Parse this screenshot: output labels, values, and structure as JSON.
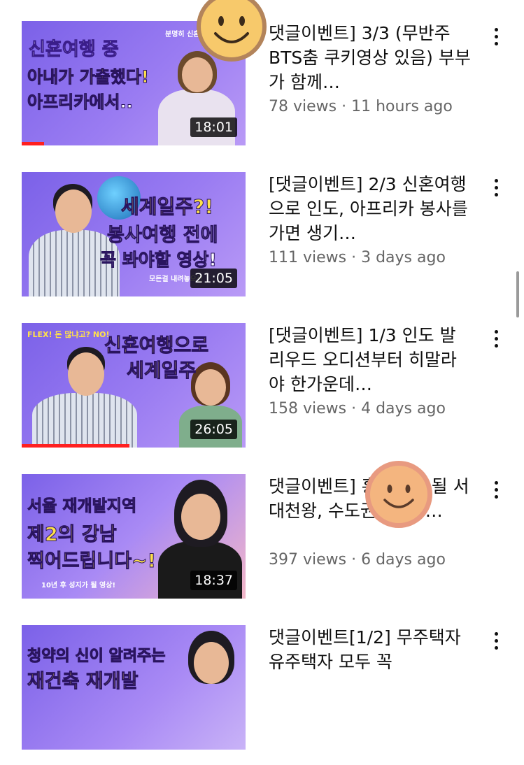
{
  "videos": [
    {
      "title": "댓글이벤트] 3/3 (무반주 BTS춤 쿠키영상 있음) 부부가 함께…",
      "meta": "78 views · 11 hours ago",
      "duration": "18:01",
      "progress": 0.1,
      "thumb_lines": [
        "신혼여행 중",
        "아내가 가출했다!",
        "아프리카에서.."
      ],
      "thumb_small": "분명히 신혼"
    },
    {
      "title": "[댓글이벤트] 2/3 신혼여행으로 인도, 아프리카 봉사를 가면 생기…",
      "meta": "111 views · 3 days ago",
      "duration": "21:05",
      "progress": 0,
      "thumb_lines": [
        "세계일주?!",
        "봉사여행 전에",
        "꼭 봐야할 영상!"
      ],
      "thumb_small": "모든걸 내려놓으신"
    },
    {
      "title": "[댓글이벤트] 1/3 인도 발리우드 오디션부터 히말라야 한가운데…",
      "meta": "158 views · 4 days ago",
      "duration": "26:05",
      "progress": 0.48,
      "thumb_lines": [
        "신혼여행으로",
        "세계일주"
      ],
      "thumb_small": "FLEX! 돈 많냐고? NO!"
    },
    {
      "title": "댓글이벤트] 흥부촌이 될 서 대천왕, 수도권 4대장…",
      "meta": "397 views · 6 days ago",
      "duration": "18:37",
      "progress": 0,
      "thumb_lines": [
        "서울 재개발지역",
        "제2의 강남",
        "찍어드립니다~!"
      ],
      "thumb_small": "10년 후 성지가 될 영상!"
    },
    {
      "title": "댓글이벤트[1/2] 무주택자 유주택자 모두 꼭",
      "meta": "",
      "duration": "",
      "progress": 0,
      "thumb_lines": [
        "청약의 신이 알려주는",
        "재건축 재개발"
      ],
      "thumb_small": ""
    }
  ],
  "colors": {
    "accent": "#ff2020",
    "thumb_bg": "#8a6ff0",
    "smiley": "#f7c96b"
  }
}
